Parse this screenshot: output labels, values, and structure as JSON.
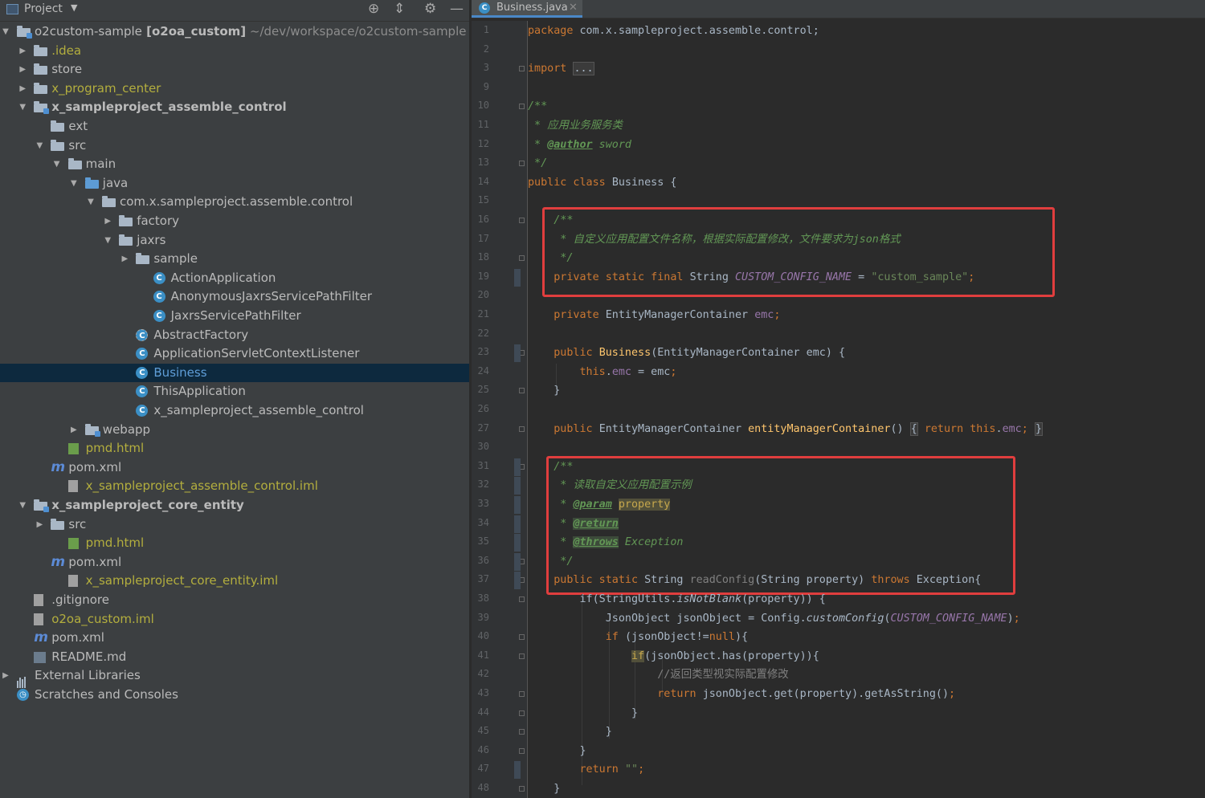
{
  "project_panel": {
    "title": "Project",
    "tree": [
      {
        "depth": 0,
        "expanded": true,
        "icon": "module-folder-icon",
        "label": "o2custom-sample",
        "bold_suffix": "[o2oa_custom]",
        "path": "~/dev/workspace/o2custom-sample",
        "color": "default"
      },
      {
        "depth": 1,
        "expanded": false,
        "icon": "folder-icon",
        "label": ".idea",
        "color": "olive"
      },
      {
        "depth": 1,
        "expanded": false,
        "icon": "folder-icon",
        "label": "store",
        "color": "default"
      },
      {
        "depth": 1,
        "expanded": false,
        "icon": "folder-icon",
        "label": "x_program_center",
        "color": "olive"
      },
      {
        "depth": 1,
        "expanded": true,
        "icon": "module-folder-icon",
        "label": "x_sampleproject_assemble_control",
        "color": "bold"
      },
      {
        "depth": 2,
        "expanded": null,
        "icon": "folder-icon",
        "label": "ext",
        "color": "default"
      },
      {
        "depth": 2,
        "expanded": true,
        "icon": "folder-icon",
        "label": "src",
        "color": "default"
      },
      {
        "depth": 3,
        "expanded": true,
        "icon": "folder-icon",
        "label": "main",
        "color": "default"
      },
      {
        "depth": 4,
        "expanded": true,
        "icon": "source-folder-icon",
        "label": "java",
        "color": "default"
      },
      {
        "depth": 5,
        "expanded": true,
        "icon": "package-icon",
        "label": "com.x.sampleproject.assemble.control",
        "color": "default"
      },
      {
        "depth": 6,
        "expanded": false,
        "icon": "package-icon",
        "label": "factory",
        "color": "default"
      },
      {
        "depth": 6,
        "expanded": true,
        "icon": "package-icon",
        "label": "jaxrs",
        "color": "default"
      },
      {
        "depth": 7,
        "expanded": false,
        "icon": "package-icon",
        "label": "sample",
        "color": "default"
      },
      {
        "depth": 8,
        "expanded": null,
        "icon": "class-icon",
        "label": "ActionApplication",
        "color": "default"
      },
      {
        "depth": 8,
        "expanded": null,
        "icon": "class-icon",
        "label": "AnonymousJaxrsServicePathFilter",
        "color": "default"
      },
      {
        "depth": 8,
        "expanded": null,
        "icon": "class-icon",
        "label": "JaxrsServicePathFilter",
        "color": "default"
      },
      {
        "depth": 7,
        "expanded": null,
        "icon": "abstract-class-icon",
        "label": "AbstractFactory",
        "color": "default"
      },
      {
        "depth": 7,
        "expanded": null,
        "icon": "class-icon",
        "label": "ApplicationServletContextListener",
        "color": "default"
      },
      {
        "depth": 7,
        "expanded": null,
        "icon": "class-icon",
        "label": "Business",
        "color": "blue",
        "selected": true
      },
      {
        "depth": 7,
        "expanded": null,
        "icon": "class-icon",
        "label": "ThisApplication",
        "color": "default"
      },
      {
        "depth": 7,
        "expanded": null,
        "icon": "class-icon",
        "label": "x_sampleproject_assemble_control",
        "color": "default"
      },
      {
        "depth": 4,
        "expanded": false,
        "icon": "web-folder-icon",
        "label": "webapp",
        "color": "default"
      },
      {
        "depth": 3,
        "expanded": null,
        "icon": "html-file-icon",
        "label": "pmd.html",
        "color": "olive"
      },
      {
        "depth": 2,
        "expanded": null,
        "icon": "maven-icon",
        "label": "pom.xml",
        "color": "default"
      },
      {
        "depth": 3,
        "expanded": null,
        "icon": "iml-file-icon",
        "label": "x_sampleproject_assemble_control.iml",
        "color": "olive"
      },
      {
        "depth": 1,
        "expanded": true,
        "icon": "module-folder-icon",
        "label": "x_sampleproject_core_entity",
        "color": "bold"
      },
      {
        "depth": 2,
        "expanded": false,
        "icon": "folder-icon",
        "label": "src",
        "color": "default"
      },
      {
        "depth": 3,
        "expanded": null,
        "icon": "html-file-icon",
        "label": "pmd.html",
        "color": "olive"
      },
      {
        "depth": 2,
        "expanded": null,
        "icon": "maven-icon",
        "label": "pom.xml",
        "color": "default"
      },
      {
        "depth": 3,
        "expanded": null,
        "icon": "iml-file-icon",
        "label": "x_sampleproject_core_entity.iml",
        "color": "olive"
      },
      {
        "depth": 1,
        "expanded": null,
        "icon": "gitignore-file-icon",
        "label": ".gitignore",
        "color": "default"
      },
      {
        "depth": 1,
        "expanded": null,
        "icon": "iml-file-icon",
        "label": "o2oa_custom.iml",
        "color": "olive"
      },
      {
        "depth": 1,
        "expanded": null,
        "icon": "maven-icon",
        "label": "pom.xml",
        "color": "default"
      },
      {
        "depth": 1,
        "expanded": null,
        "icon": "markdown-file-icon",
        "label": "README.md",
        "color": "default"
      },
      {
        "depth": 0,
        "expanded": false,
        "icon": "library-icon",
        "label": "External Libraries",
        "color": "default"
      },
      {
        "depth": 0,
        "expanded": null,
        "icon": "scratches-icon",
        "label": "Scratches and Consoles",
        "color": "default"
      }
    ]
  },
  "editor": {
    "tab_label": "Business.java",
    "line_numbers": [
      "1",
      "2",
      "3",
      "9",
      "10",
      "11",
      "12",
      "13",
      "14",
      "15",
      "16",
      "17",
      "18",
      "19",
      "20",
      "21",
      "22",
      "23",
      "24",
      "25",
      "26",
      "27",
      "30",
      "31",
      "32",
      "33",
      "34",
      "35",
      "36",
      "37",
      "38",
      "39",
      "40",
      "41",
      "42",
      "43",
      "44",
      "45",
      "46",
      "47",
      "48"
    ],
    "lines": [
      [
        {
          "t": "package ",
          "c": "kw"
        },
        {
          "t": "com.x.sampleproject.assemble.control;"
        }
      ],
      [],
      [
        {
          "t": "import ",
          "c": "kw"
        },
        {
          "t": "...",
          "c": "hlfold"
        }
      ],
      [],
      [
        {
          "t": "/**",
          "c": "cmt"
        }
      ],
      [
        {
          "t": " * 应用业务服务类",
          "c": "cmt"
        }
      ],
      [
        {
          "t": " * ",
          "c": "cmt"
        },
        {
          "t": "@author",
          "c": "tag"
        },
        {
          "t": " sword",
          "c": "cmt"
        }
      ],
      [
        {
          "t": " */",
          "c": "cmt"
        }
      ],
      [
        {
          "t": "public class ",
          "c": "kw"
        },
        {
          "t": "Business {"
        }
      ],
      [],
      [
        {
          "t": "    "
        },
        {
          "t": "/**",
          "c": "cmt"
        }
      ],
      [
        {
          "t": "    "
        },
        {
          "t": " * 自定义应用配置文件名称，根据实际配置修改，文件要求为json格式",
          "c": "cmt"
        }
      ],
      [
        {
          "t": "    "
        },
        {
          "t": " */",
          "c": "cmt"
        }
      ],
      [
        {
          "t": "    "
        },
        {
          "t": "private static final ",
          "c": "kw"
        },
        {
          "t": "String "
        },
        {
          "t": "CUSTOM_CONFIG_NAME",
          "c": "sfld"
        },
        {
          "t": " = "
        },
        {
          "t": "\"custom_sample\"",
          "c": "str"
        },
        {
          "t": ";",
          "c": "kw"
        }
      ],
      [],
      [
        {
          "t": "    "
        },
        {
          "t": "private ",
          "c": "kw"
        },
        {
          "t": "EntityManagerContainer "
        },
        {
          "t": "emc",
          "c": "fld"
        },
        {
          "t": ";",
          "c": "kw"
        }
      ],
      [],
      [
        {
          "t": "    "
        },
        {
          "t": "public ",
          "c": "kw"
        },
        {
          "t": "Business",
          "c": "fn"
        },
        {
          "t": "(EntityManagerContainer emc) {"
        }
      ],
      [
        {
          "t": "        "
        },
        {
          "t": "this",
          "c": "kw"
        },
        {
          "t": "."
        },
        {
          "t": "emc",
          "c": "fld"
        },
        {
          "t": " = emc"
        },
        {
          "t": ";",
          "c": "kw"
        }
      ],
      [
        {
          "t": "    }"
        }
      ],
      [],
      [
        {
          "t": "    "
        },
        {
          "t": "public ",
          "c": "kw"
        },
        {
          "t": "EntityManagerContainer "
        },
        {
          "t": "entityManagerContainer",
          "c": "fn"
        },
        {
          "t": "() "
        },
        {
          "t": "{",
          "c": "hlfold"
        },
        {
          "t": " "
        },
        {
          "t": "return this",
          "c": "kw"
        },
        {
          "t": "."
        },
        {
          "t": "emc",
          "c": "fld"
        },
        {
          "t": ";",
          "c": "kw"
        },
        {
          "t": " "
        },
        {
          "t": "}",
          "c": "hlfold"
        }
      ],
      [],
      [
        {
          "t": "    "
        },
        {
          "t": "/**",
          "c": "cmt"
        }
      ],
      [
        {
          "t": "    "
        },
        {
          "t": " * 读取自定义应用配置示例",
          "c": "cmt"
        }
      ],
      [
        {
          "t": "    "
        },
        {
          "t": " * ",
          "c": "cmt"
        },
        {
          "t": "@param",
          "c": "tag"
        },
        {
          "t": " "
        },
        {
          "t": "property",
          "c": "hl"
        }
      ],
      [
        {
          "t": "    "
        },
        {
          "t": " * ",
          "c": "cmt"
        },
        {
          "t": "@return",
          "c": "tag tagbg"
        }
      ],
      [
        {
          "t": "    "
        },
        {
          "t": " * ",
          "c": "cmt"
        },
        {
          "t": "@throws",
          "c": "tag tagbg"
        },
        {
          "t": " Exception",
          "c": "cmt"
        }
      ],
      [
        {
          "t": "    "
        },
        {
          "t": " */",
          "c": "cmt"
        }
      ],
      [
        {
          "t": "    "
        },
        {
          "t": "public static ",
          "c": "kw"
        },
        {
          "t": "String "
        },
        {
          "t": "readConfig",
          "c": "gray"
        },
        {
          "t": "(String property) "
        },
        {
          "t": "throws ",
          "c": "kw"
        },
        {
          "t": "Exception{"
        }
      ],
      [
        {
          "t": "        "
        },
        {
          "t": "if(StringUtils."
        },
        {
          "t": "isNotBlank",
          "c": "sm"
        },
        {
          "t": "(property)) {"
        }
      ],
      [
        {
          "t": "            "
        },
        {
          "t": "JsonObject jsonObject = Config."
        },
        {
          "t": "customConfig",
          "c": "sm"
        },
        {
          "t": "("
        },
        {
          "t": "CUSTOM_CONFIG_NAME",
          "c": "sfld"
        },
        {
          "t": ")"
        },
        {
          "t": ";",
          "c": "kw"
        }
      ],
      [
        {
          "t": "            "
        },
        {
          "t": "if ",
          "c": "kw"
        },
        {
          "t": "(jsonObject!="
        },
        {
          "t": "null",
          "c": "kw"
        },
        {
          "t": "){"
        }
      ],
      [
        {
          "t": "                "
        },
        {
          "t": "if",
          "c": "kw hl"
        },
        {
          "t": "(jsonObject.has(property)){"
        }
      ],
      [
        {
          "t": "                    "
        },
        {
          "t": "//返回类型视实际配置修改",
          "c": "lcmt"
        }
      ],
      [
        {
          "t": "                    "
        },
        {
          "t": "return ",
          "c": "kw"
        },
        {
          "t": "jsonObject.get(property).getAsString()"
        },
        {
          "t": ";",
          "c": "kw"
        }
      ],
      [
        {
          "t": "                }"
        }
      ],
      [
        {
          "t": "            }"
        }
      ],
      [
        {
          "t": "        }"
        }
      ],
      [
        {
          "t": "        "
        },
        {
          "t": "return ",
          "c": "kw"
        },
        {
          "t": "\"\"",
          "c": "str"
        },
        {
          "t": ";",
          "c": "kw"
        }
      ],
      [
        {
          "t": "    }"
        }
      ]
    ]
  },
  "colors": {
    "panel_bg": "#3c3f41",
    "editor_bg": "#2b2b2b",
    "selection": "#0d293e",
    "highlight_box": "#e03e3e",
    "keyword": "#cc7832",
    "string": "#6a8759",
    "doc_comment": "#629755"
  }
}
